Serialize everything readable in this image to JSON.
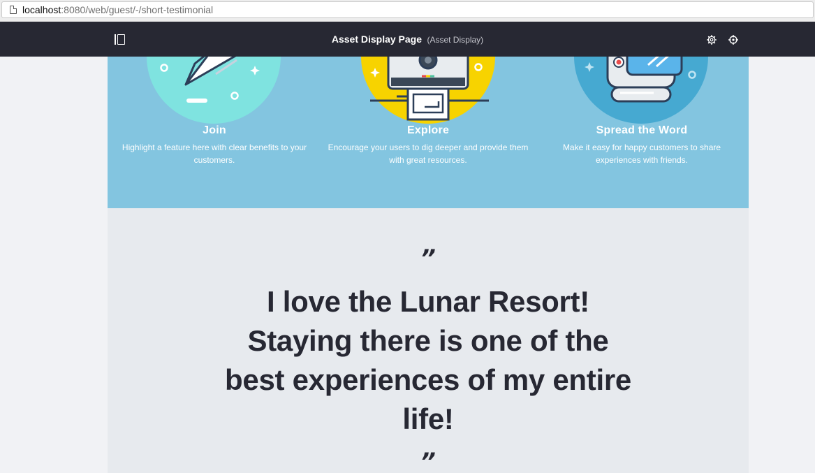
{
  "browser": {
    "url_host": "localhost",
    "url_path": ":8080/web/guest/-/short-testimonial"
  },
  "control_bar": {
    "title": "Asset Display Page",
    "subtitle": "(Asset Display)",
    "icons": [
      "sidebar-toggle-icon",
      "gear-icon",
      "crosshair-icon"
    ]
  },
  "features": [
    {
      "title": "Join",
      "description": "Highlight a feature here with clear benefits to your customers.",
      "circle_color": "#7fe3e0"
    },
    {
      "title": "Explore",
      "description": "Encourage your users to dig deeper and provide them with great resources.",
      "circle_color": "#f7d300"
    },
    {
      "title": "Spread the Word",
      "description": "Make it easy for happy customers to share experiences with friends.",
      "circle_color": "#46a9d1"
    }
  ],
  "testimonial": {
    "open_quote": "”",
    "text": "I love the Lunar Resort! Staying there is one of the best experiences of my entire life!",
    "close_quote": "”"
  },
  "colors": {
    "control_bar": "#272833",
    "features_bg": "#83c5e0",
    "testimonial_bg": "#e7eaee",
    "text_dark": "#272833"
  }
}
